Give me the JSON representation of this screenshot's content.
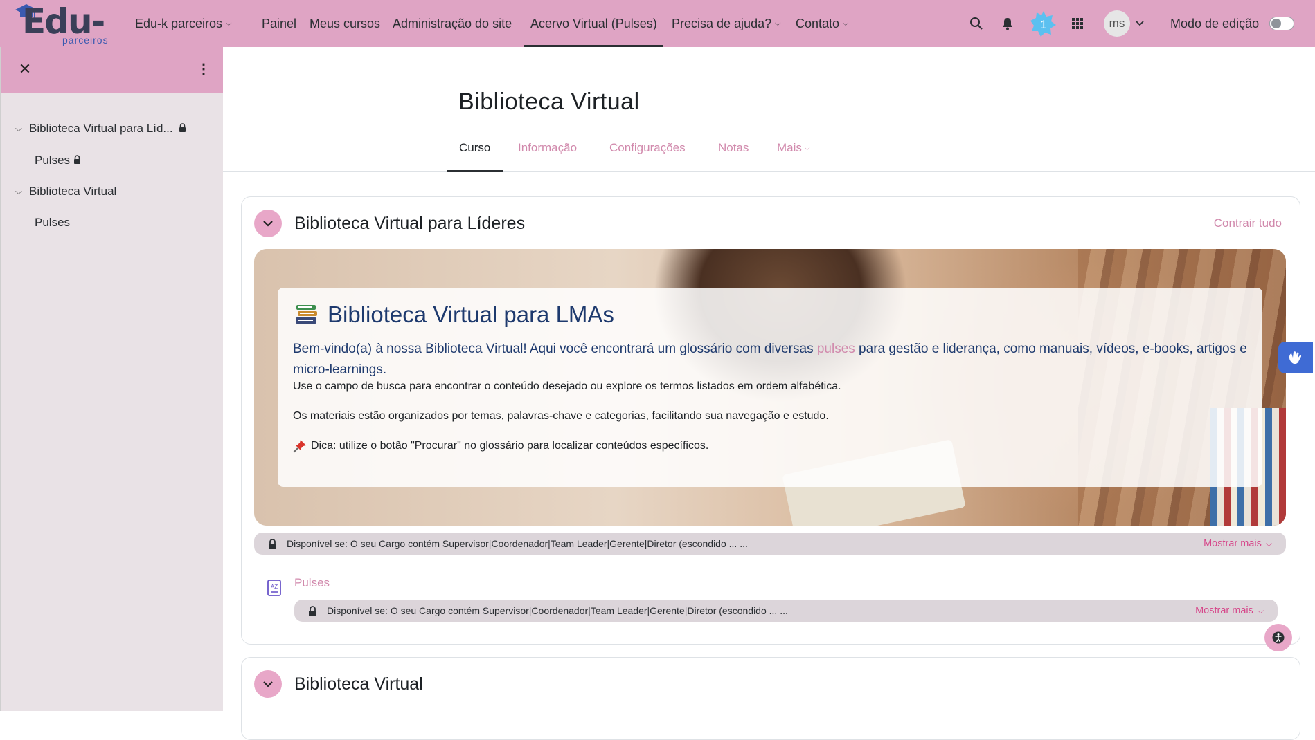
{
  "brand": {
    "name": "Edu-k",
    "tagline": "parceiros"
  },
  "nav": {
    "items": [
      {
        "label": "Edu-k parceiros",
        "caret": "⌵"
      },
      {
        "label": "Painel"
      },
      {
        "label": "Meus cursos"
      },
      {
        "label": "Administração do site"
      },
      {
        "label": "Acervo Virtual (Pulses)"
      },
      {
        "label": "Precisa de ajuda?",
        "caret": "⌵"
      },
      {
        "label": "Contato",
        "caret": "⌵"
      }
    ],
    "notification_badge": "1",
    "user_initials": "ms",
    "edit_mode_label": "Modo de edição",
    "edit_mode_on": false
  },
  "drawer": {
    "items": [
      {
        "label": "Biblioteca Virtual para Líd...",
        "locked": true,
        "expanded": true
      },
      {
        "label": "Pulses",
        "locked": true
      },
      {
        "label": "Biblioteca Virtual",
        "locked": false,
        "expanded": true
      },
      {
        "label": "Pulses",
        "locked": false
      }
    ]
  },
  "course": {
    "title": "Biblioteca Virtual",
    "tabs": [
      {
        "label": "Curso",
        "active": true
      },
      {
        "label": "Informação"
      },
      {
        "label": "Configurações"
      },
      {
        "label": "Notas"
      },
      {
        "label": "Mais",
        "caret": "⌵"
      }
    ],
    "collapse_all": "Contrair tudo"
  },
  "sections": [
    {
      "title": "Biblioteca Virtual para Líderes",
      "hero": {
        "heading": "Biblioteca Virtual para LMAs",
        "intro_before": "Bem-vindo(a) à nossa Biblioteca Virtual! Aqui você encontrará um glossário com diversas ",
        "intro_highlight": "pulses",
        "intro_after": " para gestão e liderança, como manuais, vídeos, e-books, artigos e micro-learnings.",
        "line2": "Use o campo de busca para encontrar o conteúdo desejado ou explore os termos listados em ordem alfabética.",
        "line3": "Os materiais estão organizados por temas, palavras-chave e categorias, facilitando sua navegação e estudo.",
        "tip": "Dica: utilize o botão \"Procurar\" no glossário para localizar conteúdos específicos."
      },
      "restriction": "Disponível se: O seu Cargo contém Supervisor|Coordenador|Team Leader|Gerente|Diretor (escondido ... ...",
      "show_more": "Mostrar mais",
      "activity": {
        "label": "Pulses",
        "restriction": "Disponível se: O seu Cargo contém Supervisor|Coordenador|Team Leader|Gerente|Diretor (escondido ... ...",
        "show_more": "Mostrar mais"
      }
    },
    {
      "title": "Biblioteca Virtual"
    }
  ],
  "colors": {
    "navbar": "#dfa4c4",
    "accent_pink": "#d189ac",
    "link_pink": "#d6478a",
    "drawer_bg": "#e9e2e6",
    "a11y_blue": "#3f6bd4"
  }
}
